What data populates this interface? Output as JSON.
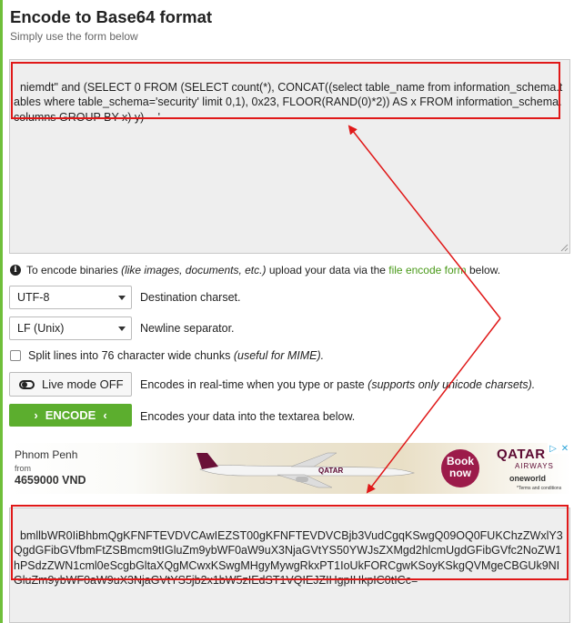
{
  "page": {
    "title": "Encode to Base64 format",
    "subtitle": "Simply use the form below"
  },
  "input": {
    "value": "niemdt\" and (SELECT 0 FROM (SELECT count(*), CONCAT((select table_name from information_schema.tables where table_schema='security' limit 0,1), 0x23, FLOOR(RAND(0)*2)) AS x FROM information_schema.columns GROUP BY x) y) -- '"
  },
  "info": {
    "prefix": "To encode binaries",
    "italic": "(like images, documents, etc.)",
    "middle": "upload your data via the",
    "link": "file encode form",
    "suffix": "below."
  },
  "options": {
    "charset": {
      "value": "UTF-8",
      "label": "Destination charset."
    },
    "newline": {
      "value": "LF (Unix)",
      "label": "Newline separator."
    },
    "split": {
      "label": "Split lines into 76 character wide chunks",
      "note": "(useful for MIME)."
    },
    "live": {
      "button": "Live mode OFF",
      "label": "Encodes in real-time when you type or paste",
      "note": "(supports only unicode charsets)."
    },
    "encode": {
      "button": "ENCODE",
      "label": "Encodes your data into the textarea below."
    }
  },
  "ad": {
    "city": "Phnom Penh",
    "from": "from",
    "price": "4659000 VND",
    "book": "Book now",
    "brand": "QATAR",
    "brand_sub": "AIRWAYS",
    "alliance": "oneworld",
    "terms": "*Terms and conditions",
    "plane_text": "QATAR"
  },
  "output": {
    "value": "bmllbWR0IiBhbmQgKFNFTEVDVCAwIEZST00gKFNFTEVDVCBjb3VudCgqKSwgQ09OQ0FUKChzZWxlY3QgdGFibGVfbmFtZSBmcm9tIGluZm9ybWF0aW9uX3NjaGVtYS50YWJsZXMgd2hlcmUgdGFibGVfc2NoZW1hPSdzZWN1cml0eScgbGltaXQgMCwxKSwgMHgyMywgRkxPT1IoUkFORCgwKSoyKSkgQVMgeCBGUk9NIGluZm9ybWF0aW9uX3NjaGVtYS5jb2x1bW5zIEdST1VQIEJZIHgpIHkpIC0tICc="
  },
  "colors": {
    "accent_green": "#5cae2e",
    "link_green": "#4a9a1a",
    "highlight_red": "#e01818"
  }
}
